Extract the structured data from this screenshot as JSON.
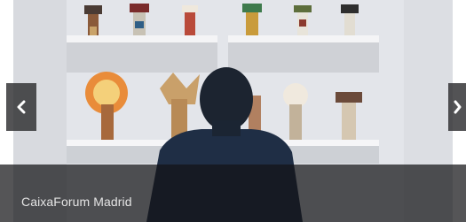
{
  "slider": {
    "caption": "CaixaForum Madrid",
    "prev_icon": "chevron-left-icon",
    "next_icon": "chevron-right-icon",
    "colors": {
      "caption_bg": "#141416",
      "caption_text": "#e4e4e4",
      "arrow_bg": "#2d2d30",
      "arrow_icon": "#ffffff"
    }
  }
}
